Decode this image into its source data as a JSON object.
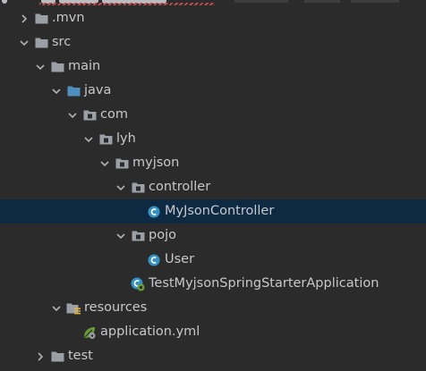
{
  "tree": {
    "mvn": {
      "label": ".mvn",
      "icon": "folder-icon",
      "state": "collapsed"
    },
    "src": {
      "label": "src",
      "icon": "folder-icon",
      "state": "expanded"
    },
    "main": {
      "label": "main",
      "icon": "folder-icon",
      "state": "expanded"
    },
    "java": {
      "label": "java",
      "icon": "source-root-folder-icon",
      "state": "expanded"
    },
    "com": {
      "label": "com",
      "icon": "package-icon",
      "state": "expanded"
    },
    "lyh": {
      "label": "lyh",
      "icon": "package-icon",
      "state": "expanded"
    },
    "myjson": {
      "label": "myjson",
      "icon": "package-icon",
      "state": "expanded"
    },
    "controller": {
      "label": "controller",
      "icon": "package-icon",
      "state": "expanded"
    },
    "myjsoncontroller": {
      "label": "MyJsonController",
      "icon": "java-class-icon",
      "selected": true
    },
    "pojo": {
      "label": "pojo",
      "icon": "package-icon",
      "state": "expanded"
    },
    "user": {
      "label": "User",
      "icon": "java-class-icon"
    },
    "app": {
      "label": "TestMyjsonSpringStarterApplication",
      "icon": "spring-boot-class-icon"
    },
    "resources": {
      "label": "resources",
      "icon": "resources-folder-icon",
      "state": "expanded"
    },
    "appyml": {
      "label": "application.yml",
      "icon": "spring-yml-icon"
    },
    "test": {
      "label": "test",
      "icon": "folder-icon",
      "state": "collapsed"
    }
  },
  "colors": {
    "background": "#2b2b2b",
    "selection": "#0e2a42",
    "text": "#c5c8cc",
    "class_icon": "#3592c4",
    "spring": "#6a9a3a",
    "resources_accent": "#e0b53a"
  }
}
